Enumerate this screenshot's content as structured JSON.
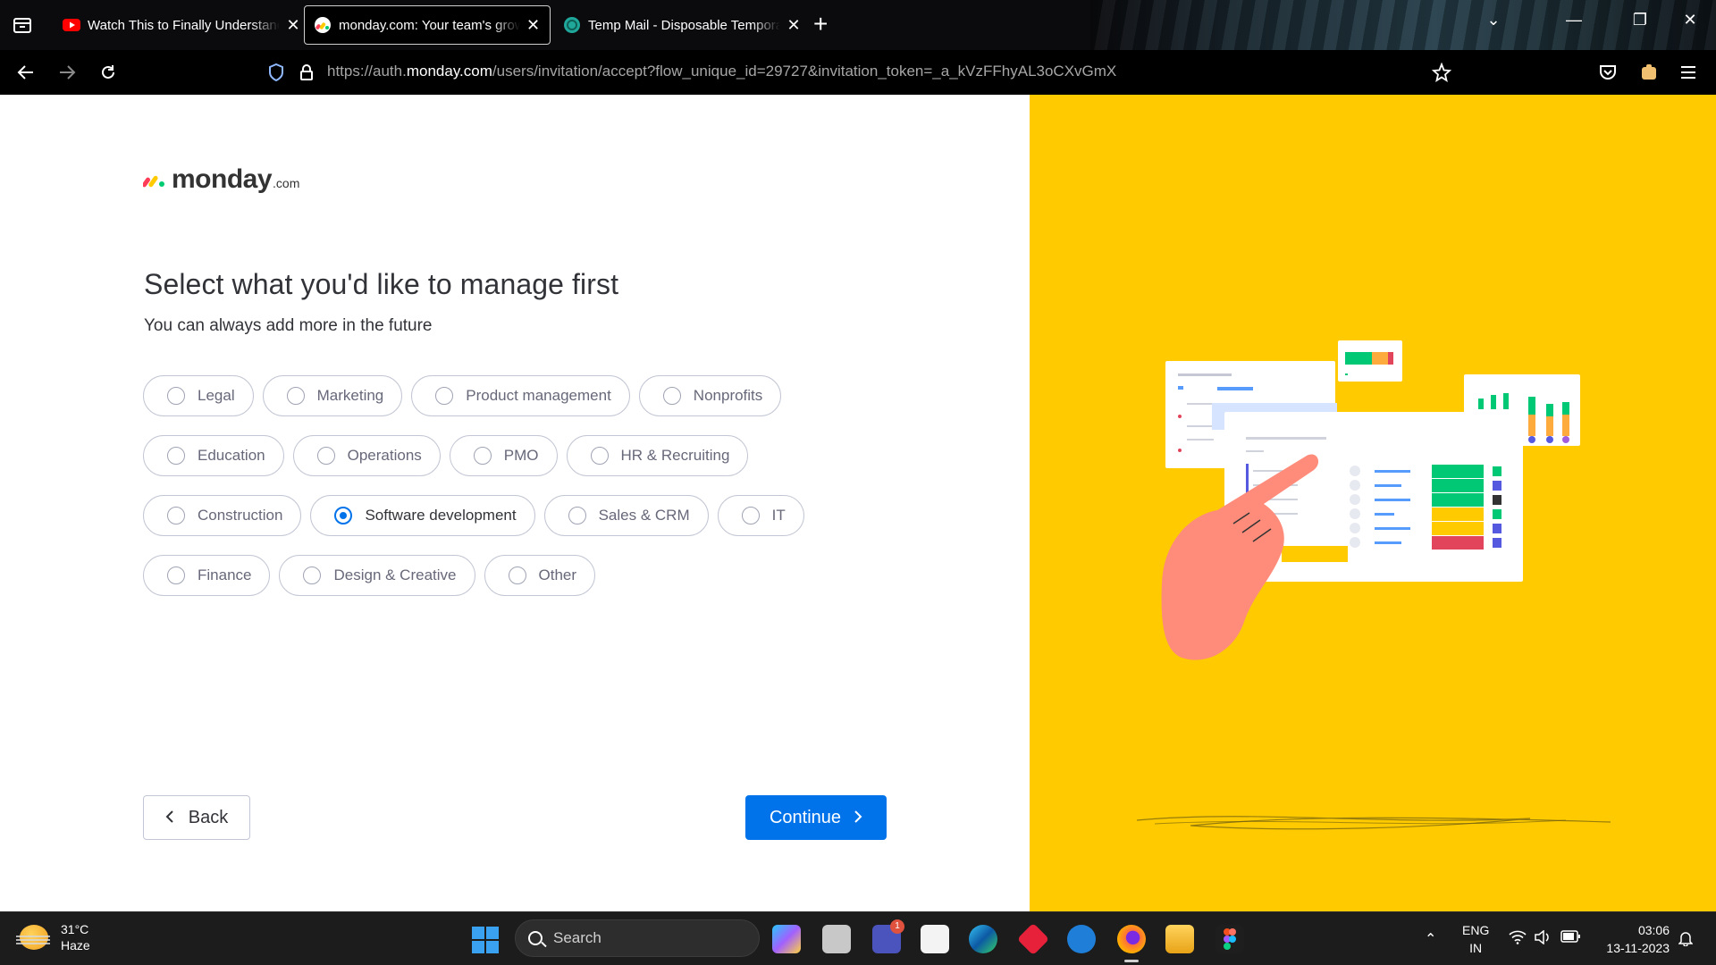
{
  "browser": {
    "tabs": [
      {
        "title": "Watch This to Finally Understand",
        "favicon": "youtube-icon",
        "active": false
      },
      {
        "title": "monday.com: Your team's growth",
        "favicon": "monday-icon",
        "active": true
      },
      {
        "title": "Temp Mail - Disposable Temporary",
        "favicon": "tempmail-icon",
        "active": false
      }
    ],
    "url_prefix": "https://auth.",
    "url_domain": "monday.com",
    "url_rest": "/users/invitation/accept?flow_unique_id=29727&invitation_token=_a_kVzFFhyAL3oCXvGmX"
  },
  "page": {
    "logo_word": "monday",
    "logo_suffix": ".com",
    "title": "Select what you'd like to manage first",
    "subtitle": "You can always add more in the future",
    "options": [
      [
        "Legal",
        "Marketing",
        "Product management",
        "Nonprofits"
      ],
      [
        "Education",
        "Operations",
        "PMO",
        "HR & Recruiting"
      ],
      [
        "Construction",
        "Software development",
        "Sales & CRM",
        "IT"
      ],
      [
        "Finance",
        "Design & Creative",
        "Other"
      ]
    ],
    "selected": "Software development",
    "back_label": "Back",
    "continue_label": "Continue"
  },
  "colors": {
    "accent": "#0073ea",
    "illustration_bg": "#ffcb00"
  },
  "taskbar": {
    "weather_temp": "31°C",
    "weather_cond": "Haze",
    "search_label": "Search",
    "lang_top": "ENG",
    "lang_bottom": "IN",
    "time": "03:06",
    "date": "13-11-2023",
    "teams_badge": "1"
  }
}
